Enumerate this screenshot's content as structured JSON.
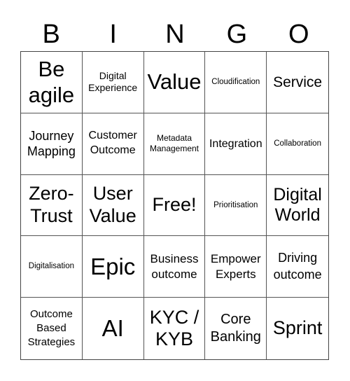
{
  "header": {
    "letters": [
      "B",
      "I",
      "N",
      "G",
      "O"
    ]
  },
  "cells": [
    "Be agile",
    "Digital Experience",
    "Value",
    "Cloudification",
    "Service",
    "Journey Mapping",
    "Customer Outcome",
    "Metadata Management",
    "Integration",
    "Collaboration",
    "Zero-Trust",
    "User Value",
    "Free!",
    "Prioritisation",
    "Digital World",
    "Digitalisation",
    "Epic",
    "Business outcome",
    "Empower Experts",
    "Driving outcome",
    "Outcome Based Strategies",
    "AI",
    "KYC / KYB",
    "Core Banking",
    "Sprint"
  ]
}
